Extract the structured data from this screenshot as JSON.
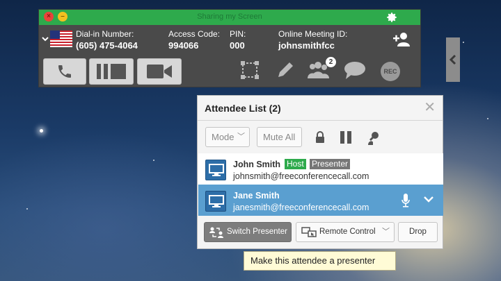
{
  "toolbar": {
    "title": "Sharing my Screen",
    "dial_in": {
      "label": "Dial-in Number:",
      "value": "(605) 475-4064"
    },
    "access_code": {
      "label": "Access Code:",
      "value": "994066"
    },
    "pin": {
      "label": "PIN:",
      "value": "000"
    },
    "meeting_id": {
      "label": "Online Meeting ID:",
      "value": "johnsmithfcc"
    },
    "participants_badge": "2",
    "rec_label": "REC",
    "accent_color": "#2eaa4c"
  },
  "attendee_panel": {
    "title": "Attendee List (2)",
    "mode_select": "Mode",
    "mute_all": "Mute All",
    "attendees": [
      {
        "name": "John Smith",
        "email": "johnsmith@freeconferencecall.com",
        "tags": [
          "Host",
          "Presenter"
        ],
        "selected": false
      },
      {
        "name": "Jane Smith",
        "email": "janesmith@freeconferencecall.com",
        "tags": [],
        "selected": true
      }
    ],
    "actions": {
      "switch_presenter": "Switch Presenter",
      "remote_control": "Remote Control",
      "drop": "Drop"
    },
    "selection_color": "#5a9fd0"
  },
  "tooltip": {
    "text": "Make this attendee a presenter"
  }
}
